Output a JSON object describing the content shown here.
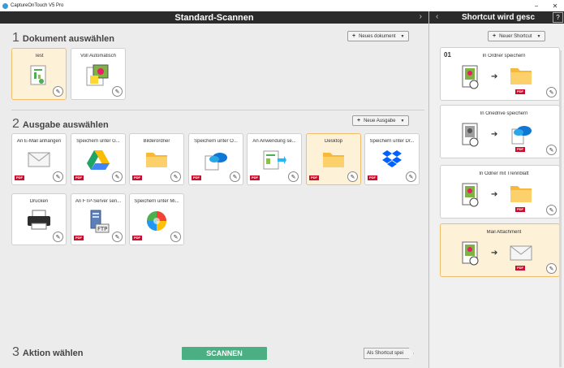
{
  "window": {
    "title": "CaptureOnTouch V5 Pro",
    "minimize": "−",
    "close": "✕"
  },
  "main": {
    "header_title": "Standard-Scannen",
    "header_arrow": "›",
    "section1": {
      "num": "1",
      "label": "Dokument auswählen",
      "add_button": "Neues dokument"
    },
    "section2": {
      "num": "2",
      "label": "Ausgabe auswählen",
      "add_button": "Neue Ausgabe"
    },
    "section3": {
      "num": "3",
      "label": "Aktion wählen"
    },
    "documents": [
      {
        "label": "Test",
        "icon": "document-chart-icon",
        "selected": true
      },
      {
        "label": "Voll Automatisch",
        "icon": "photo-document-icon",
        "selected": false
      }
    ],
    "outputs": [
      {
        "label": "An E-Mail anhängen",
        "icon": "envelope-icon",
        "pdf": "PDF"
      },
      {
        "label": "Speichern unter G...",
        "icon": "google-drive-icon",
        "pdf": "PDF"
      },
      {
        "label": "Bilderordner",
        "icon": "folder-icon",
        "pdf": "PDF"
      },
      {
        "label": "Speichern unter O...",
        "icon": "onedrive-icon",
        "pdf": "PDF"
      },
      {
        "label": "An Anwendung se...",
        "icon": "application-icon",
        "pdf": "PDF"
      },
      {
        "label": "Desktop",
        "icon": "folder-icon",
        "pdf": "PDF",
        "selected": true
      },
      {
        "label": "Speichern unter Dr...",
        "icon": "dropbox-icon",
        "pdf": "PDF"
      },
      {
        "label": "Drucken",
        "icon": "printer-icon",
        "pdf": ""
      },
      {
        "label": "An FTP-Server sen...",
        "icon": "ftp-server-icon",
        "pdf": "PDF"
      },
      {
        "label": "Speichern unter Mi...",
        "icon": "sharepoint-icon",
        "pdf": "PDF"
      }
    ],
    "scan_button": "SCANNEN",
    "shortcut_save": "Als Shortcut spei"
  },
  "side": {
    "title": "Shortcut wird gesc",
    "back": "‹",
    "help": "?",
    "add_button": "Neuer Shortcut",
    "shortcuts": [
      {
        "num": "01",
        "label": "In Ordner speichern",
        "dest_icon": "folder-icon",
        "pdf": "PDF"
      },
      {
        "num": "",
        "label": "In Onedrive speichern",
        "dest_icon": "onedrive-icon",
        "pdf": "PDF"
      },
      {
        "num": "",
        "label": "In Odner mit Trennblatt",
        "dest_icon": "folder-icon",
        "pdf": "PDF"
      },
      {
        "num": "",
        "label": "Mail Attachment",
        "dest_icon": "envelope-icon",
        "pdf": "PDF",
        "selected": true
      }
    ]
  },
  "colors": {
    "header": "#2b2b2b",
    "selected_bg": "#fdf1d8",
    "selected_border": "#f0be6a",
    "scan": "#4caf83",
    "pdf": "#c8102e"
  }
}
